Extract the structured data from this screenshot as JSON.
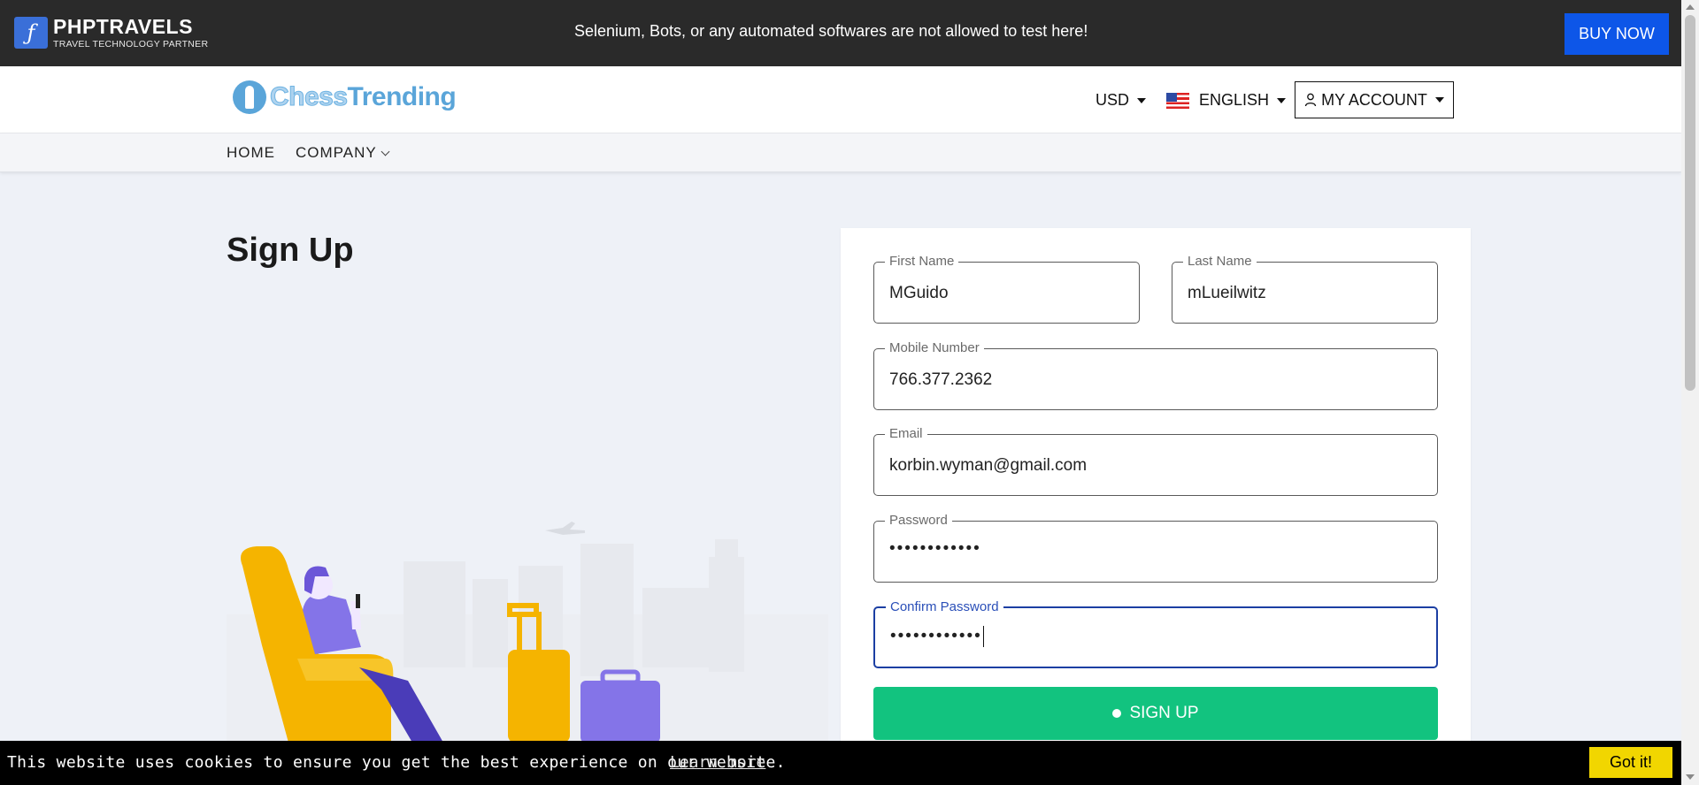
{
  "topbar": {
    "brand_name": "PHPTRAVELS",
    "brand_tagline": "TRAVEL TECHNOLOGY PARTNER",
    "notice": "Selenium, Bots, or any automated softwares are not allowed to test here!",
    "buy_now": "BUY NOW"
  },
  "header": {
    "logo_part1": "Chess",
    "logo_part2": "Trending",
    "currency": "USD",
    "language": "ENGLISH",
    "account": "MY ACCOUNT"
  },
  "nav": {
    "home": "HOME",
    "company": "COMPANY"
  },
  "page": {
    "title": "Sign Up"
  },
  "form": {
    "first_name": {
      "label": "First Name",
      "value": "MGuido"
    },
    "last_name": {
      "label": "Last Name",
      "value": "mLueilwitz"
    },
    "mobile": {
      "label": "Mobile Number",
      "value": "766.377.2362"
    },
    "email": {
      "label": "Email",
      "value": "korbin.wyman@gmail.com"
    },
    "password": {
      "label": "Password",
      "value": "••••••••••••"
    },
    "confirm_password": {
      "label": "Confirm Password",
      "value": "••••••••••••"
    },
    "submit": "SIGN UP"
  },
  "cookie": {
    "message": "This website uses cookies to ensure you get the best experience on our website.",
    "learn_more": "Learn more",
    "accept": "Got it!"
  },
  "colors": {
    "topbar_bg": "#2a2a2a",
    "buy_now_bg": "#0d56e8",
    "signup_bg": "#12c37f",
    "focus_border": "#1c3fa3",
    "cookie_button": "#f1d600"
  },
  "icons": [
    "phptravels-logo-icon",
    "chesstrending-logo-icon",
    "us-flag-icon",
    "user-icon",
    "caret-down-icon",
    "chevron-down-icon"
  ]
}
